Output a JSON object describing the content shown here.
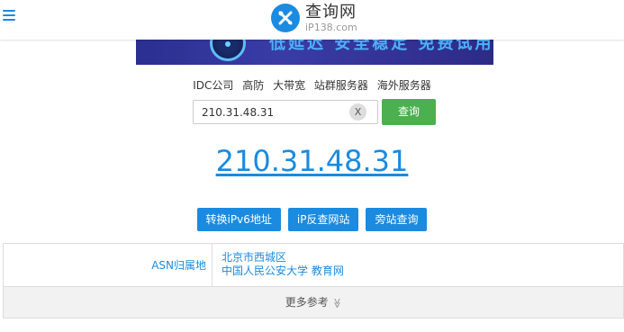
{
  "header": {
    "logo_name": "查询网",
    "logo_domain": "iP138.com"
  },
  "banner": {
    "text": "低延迟 安全稳定 免费试用"
  },
  "links": [
    "IDC公司",
    "高防",
    "大带宽",
    "站群服务器",
    "海外服务器"
  ],
  "search": {
    "value": "210.31.48.31",
    "clear_label": "X",
    "button_label": "查询"
  },
  "result": {
    "ip": "210.31.48.31"
  },
  "actions": [
    "转换iPv6地址",
    "iP反查网站",
    "旁站查询"
  ],
  "table": {
    "label": "ASN归属地",
    "value_line1": "北京市西城区",
    "value_line2": "中国人民公安大学 教育网",
    "more_label": "更多参考"
  },
  "colors": {
    "accent": "#1a8be0",
    "green": "#4caf50"
  }
}
